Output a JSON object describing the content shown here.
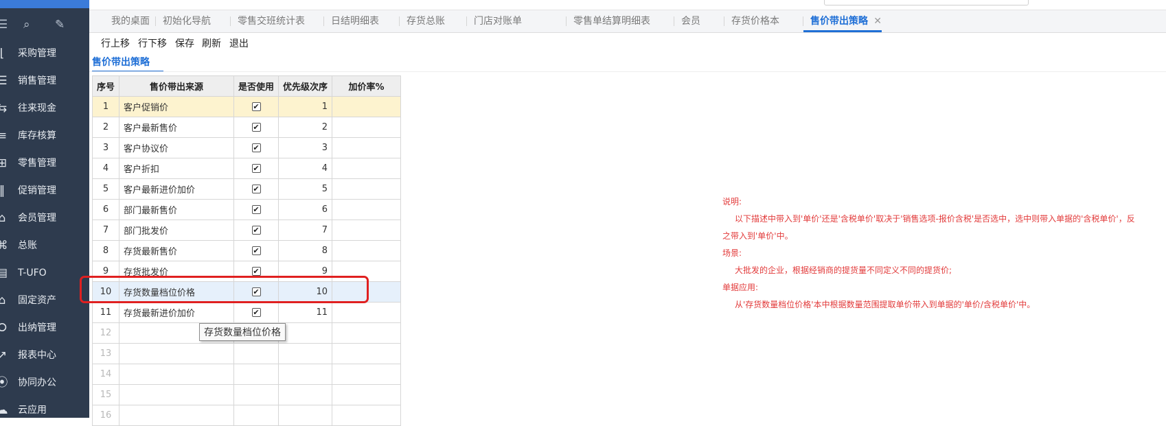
{
  "sidebar": {
    "items": [
      {
        "label": "采购管理",
        "icon": "purchase-icon",
        "glyph": "⌊"
      },
      {
        "label": "销售管理",
        "icon": "sales-icon",
        "glyph": "☰"
      },
      {
        "label": "往来现金",
        "icon": "cash-icon",
        "glyph": "⇆"
      },
      {
        "label": "库存核算",
        "icon": "inventory-icon",
        "glyph": "≡"
      },
      {
        "label": "零售管理",
        "icon": "retail-icon",
        "glyph": "⊞"
      },
      {
        "label": "促销管理",
        "icon": "promotion-icon",
        "glyph": "‖"
      },
      {
        "label": "会员管理",
        "icon": "member-icon",
        "glyph": "⌂"
      },
      {
        "label": "总账",
        "icon": "ledger-icon",
        "glyph": "⌘"
      },
      {
        "label": "T-UFO",
        "icon": "report-sheet-icon",
        "glyph": "▤"
      },
      {
        "label": "固定资产",
        "icon": "asset-icon",
        "glyph": "⌂"
      },
      {
        "label": "出纳管理",
        "icon": "cashier-icon",
        "glyph": "⭘"
      },
      {
        "label": "报表中心",
        "icon": "report-center-icon",
        "glyph": "↗"
      },
      {
        "label": "协同办公",
        "icon": "collaboration-icon",
        "glyph": "⦿"
      },
      {
        "label": "云应用",
        "icon": "cloud-icon",
        "glyph": "☁"
      }
    ]
  },
  "tabs": [
    {
      "label": "我的桌面"
    },
    {
      "label": "初始化导航"
    },
    {
      "label": "零售交班统计表"
    },
    {
      "label": "日结明细表"
    },
    {
      "label": "存货总账"
    },
    {
      "label": "门店对账单"
    },
    {
      "label": "零售单结算明细表"
    },
    {
      "label": "会员"
    },
    {
      "label": "存货价格本"
    },
    {
      "label": "售价带出策略",
      "active": true
    }
  ],
  "toolbar": {
    "move_up": "行上移",
    "move_down": "行下移",
    "save": "保存",
    "refresh": "刷新",
    "exit": "退出"
  },
  "section_title": "售价带出策略",
  "grid": {
    "headers": [
      "序号",
      "售价带出来源",
      "是否使用",
      "优先级次序",
      "加价率%"
    ],
    "rows": [
      {
        "no": "1",
        "source": "客户促销价",
        "used": true,
        "priority": "1",
        "markup": ""
      },
      {
        "no": "2",
        "source": "客户最新售价",
        "used": true,
        "priority": "2",
        "markup": ""
      },
      {
        "no": "3",
        "source": "客户协议价",
        "used": true,
        "priority": "3",
        "markup": ""
      },
      {
        "no": "4",
        "source": "客户折扣",
        "used": true,
        "priority": "4",
        "markup": ""
      },
      {
        "no": "5",
        "source": "客户最新进价加价",
        "used": true,
        "priority": "5",
        "markup": ""
      },
      {
        "no": "6",
        "source": "部门最新售价",
        "used": true,
        "priority": "6",
        "markup": ""
      },
      {
        "no": "7",
        "source": "部门批发价",
        "used": true,
        "priority": "7",
        "markup": ""
      },
      {
        "no": "8",
        "source": "存货最新售价",
        "used": true,
        "priority": "8",
        "markup": ""
      },
      {
        "no": "9",
        "source": "存货批发价",
        "used": true,
        "priority": "9",
        "markup": ""
      },
      {
        "no": "10",
        "source": "存货数量档位价格",
        "used": true,
        "priority": "10",
        "markup": ""
      },
      {
        "no": "11",
        "source": "存货最新进价加价",
        "used": true,
        "priority": "11",
        "markup": ""
      },
      {
        "no": "12",
        "source": "",
        "used": false,
        "priority": "",
        "markup": ""
      },
      {
        "no": "13",
        "source": "",
        "used": false,
        "priority": "",
        "markup": ""
      },
      {
        "no": "14",
        "source": "",
        "used": false,
        "priority": "",
        "markup": ""
      },
      {
        "no": "15",
        "source": "",
        "used": false,
        "priority": "",
        "markup": ""
      },
      {
        "no": "16",
        "source": "",
        "used": false,
        "priority": "",
        "markup": ""
      }
    ],
    "selected_row": "1",
    "current_row": "10"
  },
  "tooltip": "存货数量档位价格",
  "notes": {
    "desc_title": "说明:",
    "desc_text_1": "以下描述中带入到'单价'还是'含税单价'取决于'销售选项-报价含税'是否选中，选中则带入单据的'含税单价'，反",
    "desc_text_2": "之带入到'单价'中。",
    "scene_title": "场景:",
    "scene_text": "大批发的企业，根据经销商的提货量不同定义不同的提货价;",
    "apply_title": "单据应用:",
    "apply_text": "从'存货数量档位价格'本中根据数量范围提取单价带入到单据的'单价/含税单价'中。"
  },
  "colors": {
    "accent": "#1f6fd6",
    "sidebar_bg": "#2e3b4e",
    "highlight_border": "#e02020",
    "notes_text": "#e23a3a",
    "selected_row_bg": "#fdf3cf",
    "current_row_bg": "#e6f0fb"
  }
}
